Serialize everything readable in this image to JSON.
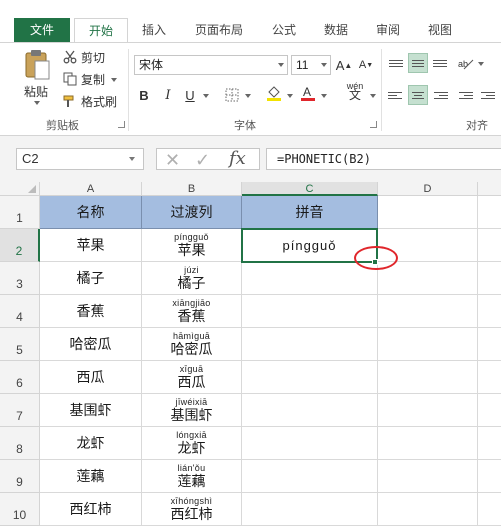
{
  "ribbon": {
    "tabs": [
      "文件",
      "开始",
      "插入",
      "页面布局",
      "公式",
      "数据",
      "审阅",
      "视图"
    ],
    "active_tab": "开始",
    "clipboard": {
      "paste_label": "粘贴",
      "cut_label": "剪切",
      "copy_label": "复制",
      "format_painter_label": "格式刷",
      "group_label": "剪贴板"
    },
    "font": {
      "font_name": "宋体",
      "font_size": "11",
      "grow_label": "A",
      "shrink_label": "A",
      "bold_label": "B",
      "italic_label": "I",
      "underline_label": "U",
      "wen_label": "wén",
      "group_label": "字体"
    },
    "alignment": {
      "group_label": "对齐"
    }
  },
  "formula_bar": {
    "name_box": "C2",
    "cancel_symbol": "✕",
    "enter_symbol": "✓",
    "fx_label": "fx",
    "formula": "=PHONETIC(B2)"
  },
  "sheet": {
    "columns": [
      "A",
      "B",
      "C",
      "D"
    ],
    "selected_column": "C",
    "rows": [
      "1",
      "2",
      "3",
      "4",
      "5",
      "6",
      "7",
      "8",
      "9",
      "10"
    ],
    "selected_row": "2",
    "headers": [
      "名称",
      "过渡列",
      "拼音"
    ],
    "data": [
      {
        "name": "苹果",
        "pinyin_above": "píngguǒ",
        "hanzi": "苹果",
        "result": "píngguǒ"
      },
      {
        "name": "橘子",
        "pinyin_above": "júzi",
        "hanzi": "橘子",
        "result": ""
      },
      {
        "name": "香蕉",
        "pinyin_above": "xiāngjiāo",
        "hanzi": "香蕉",
        "result": ""
      },
      {
        "name": "哈密瓜",
        "pinyin_above": "hāmìguā",
        "hanzi": "哈密瓜",
        "result": ""
      },
      {
        "name": "西瓜",
        "pinyin_above": "xīguā",
        "hanzi": "西瓜",
        "result": ""
      },
      {
        "name": "基围虾",
        "pinyin_above": "jīwéixiā",
        "hanzi": "基围虾",
        "result": ""
      },
      {
        "name": "龙虾",
        "pinyin_above": "lóngxiā",
        "hanzi": "龙虾",
        "result": ""
      },
      {
        "name": "莲藕",
        "pinyin_above": "lián'ǒu",
        "hanzi": "莲藕",
        "result": ""
      },
      {
        "name": "西红柿",
        "pinyin_above": "xīhóngshì",
        "hanzi": "西红柿",
        "result": ""
      }
    ]
  },
  "colors": {
    "accent": "#217346",
    "header_fill": "#a4bde0",
    "highlight_circle": "#e0262b"
  }
}
